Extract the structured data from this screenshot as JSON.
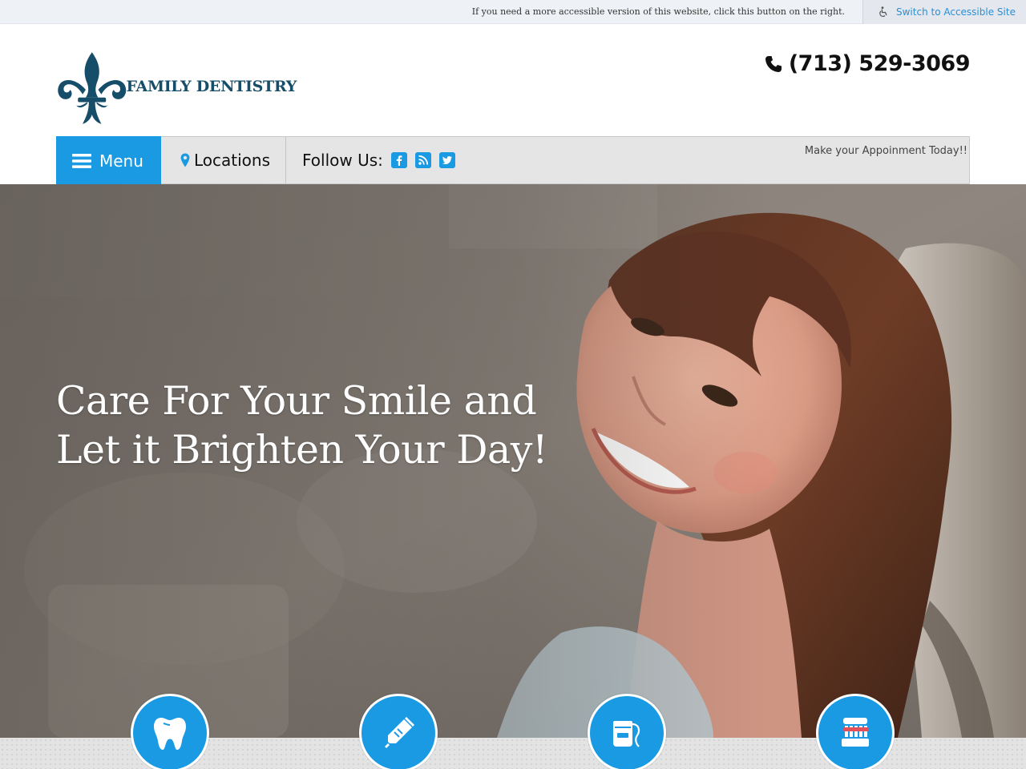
{
  "accessibility_bar": {
    "message": "If you need a more accessible version of this website, click this button on the right.",
    "button_label": "Switch to Accessible Site"
  },
  "header": {
    "logo_text": "FAMILY DENTISTRY",
    "phone": "(713) 529-3069"
  },
  "nav": {
    "menu_label": "Menu",
    "locations_label": "Locations",
    "follow_label": "Follow Us:",
    "social": [
      "facebook-icon",
      "rss-icon",
      "twitter-icon"
    ],
    "cta": "Make your Appoinment Today!!"
  },
  "hero": {
    "title_line1": "Care For Your Smile and",
    "title_line2": "Let it Brighten Your Day!"
  },
  "services": {
    "icons": [
      "tooth-icon",
      "toothpaste-icon",
      "floss-icon",
      "toothbrush-icon"
    ]
  },
  "colors": {
    "accent": "#1a9ae2",
    "logo": "#164d68",
    "nav_bg": "#e5e5e5"
  }
}
